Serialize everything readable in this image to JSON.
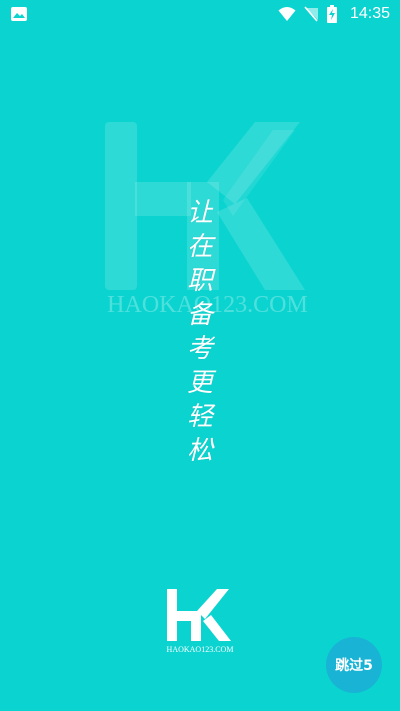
{
  "status_bar": {
    "time": "14:35",
    "icons": [
      "image-icon",
      "wifi-icon",
      "no-sim-icon",
      "battery-charging-icon"
    ]
  },
  "splash": {
    "watermark_text": "HAOKAO123.COM",
    "slogan_chars": [
      "让",
      "在",
      "职",
      "备",
      "考",
      "更",
      "轻",
      "松"
    ],
    "logo_letters": "HK",
    "logo_caption": "HAOKAO123.COM"
  },
  "skip": {
    "label": "跳过5"
  },
  "colors": {
    "background": "#0bd4d0",
    "skip_button": "#19b3d6",
    "text": "#ffffff"
  }
}
